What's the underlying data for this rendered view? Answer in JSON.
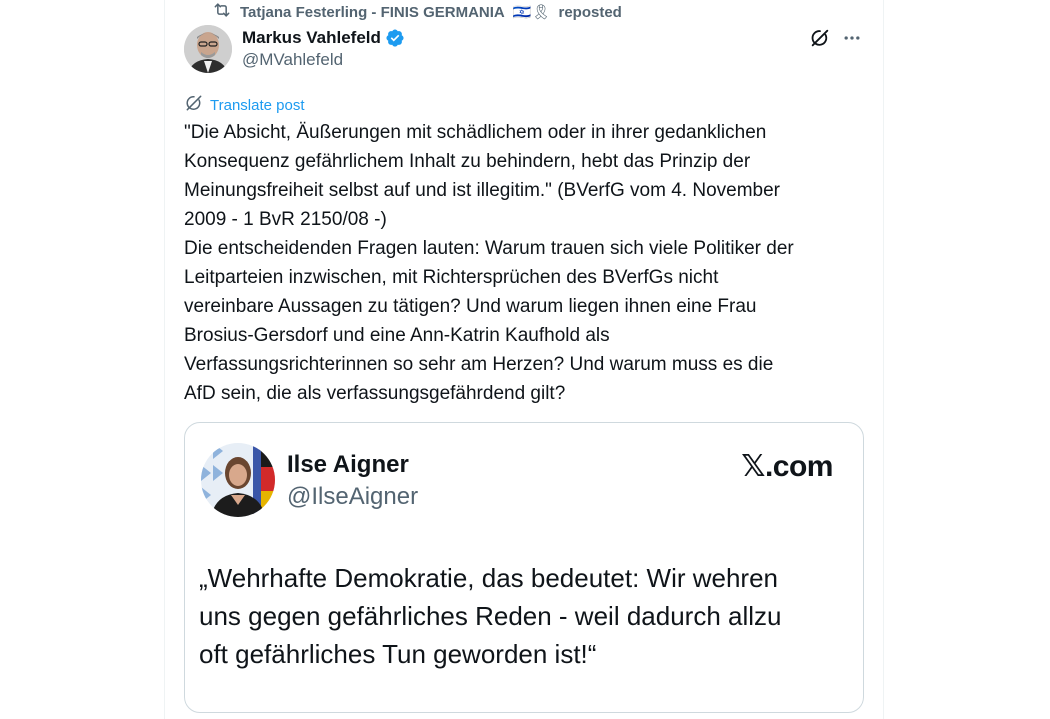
{
  "repost": {
    "user": "Tatjana Festerling - FINIS GERMANIA",
    "emojis": "🇮🇱🎗",
    "label": "reposted"
  },
  "author": {
    "name": "Markus Vahlefeld",
    "handle": "@MVahlefeld",
    "verified": true
  },
  "actions": {
    "grok_icon": "grok-icon",
    "more_icon": "more-dots-icon"
  },
  "translate": {
    "label": "Translate post"
  },
  "post": {
    "text": "\"Die Absicht, Äußerungen mit schädlichem oder in ihrer gedanklichen\nKonsequenz gefährlichem Inhalt zu behindern, hebt das Prinzip der\nMeinungsfreiheit selbst auf und ist illegitim.\" (BVerfG vom 4. November\n2009 - 1 BvR 2150/08 -)\nDie entscheidenden Fragen lauten: Warum trauen sich viele Politiker der\nLeitparteien inzwischen, mit Richtersprüchen des BVerfGs nicht\nvereinbare Aussagen zu tätigen? Und warum liegen ihnen eine Frau\nBrosius-Gersdorf und eine Ann-Katrin Kaufhold als\nVerfassungsrichterinnen so sehr am Herzen? Und warum muss es die\nAfD sein, die als verfassungsgefährdend gilt?"
  },
  "embed": {
    "name": "Ilse Aigner",
    "handle": "@IlseAigner",
    "brand": "𝕏.com",
    "quote": "„Wehrhafte Demokratie, das bedeutet: Wir wehren\nuns gegen gefährliches Reden - weil dadurch allzu\noft gefährliches Tun geworden ist!“"
  },
  "colors": {
    "text_primary": "#0f1419",
    "text_secondary": "#536471",
    "accent": "#1d9bf0",
    "border": "#cfd9de"
  }
}
